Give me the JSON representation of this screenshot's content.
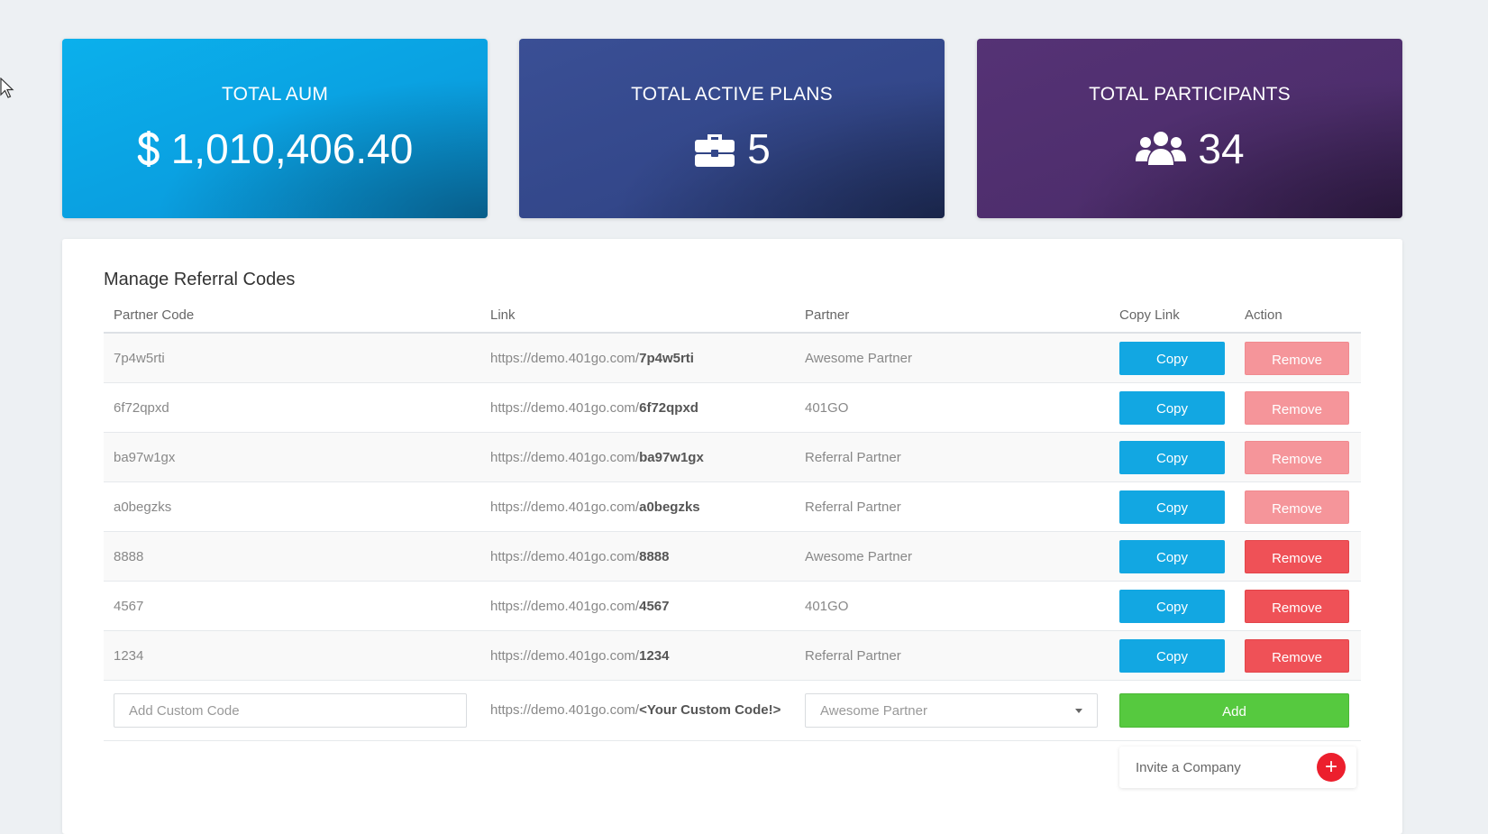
{
  "stats": [
    {
      "label": "TOTAL AUM",
      "value": "1,010,406.40",
      "icon": "dollar-icon",
      "color": "#0aa8e6"
    },
    {
      "label": "TOTAL ACTIVE PLANS",
      "value": "5",
      "icon": "briefcase-icon",
      "color": "#33478a"
    },
    {
      "label": "TOTAL PARTICIPANTS",
      "value": "34",
      "icon": "users-icon",
      "color": "#4e2e6d"
    }
  ],
  "referral": {
    "title": "Manage Referral Codes",
    "columns": [
      "Partner Code",
      "Link",
      "Partner",
      "Copy Link",
      "Action"
    ],
    "link_base": "https://demo.401go.com/",
    "rows": [
      {
        "code": "7p4w5rti",
        "partner": "Awesome Partner",
        "copy": "Copy",
        "remove": "Remove"
      },
      {
        "code": "6f72qpxd",
        "partner": "401GO",
        "copy": "Copy",
        "remove": "Remove"
      },
      {
        "code": "ba97w1gx",
        "partner": "Referral Partner",
        "copy": "Copy",
        "remove": "Remove"
      },
      {
        "code": "a0begzks",
        "partner": "Referral Partner",
        "copy": "Copy",
        "remove": "Remove"
      },
      {
        "code": "8888",
        "partner": "Awesome Partner",
        "copy": "Copy",
        "remove": "Remove"
      },
      {
        "code": "4567",
        "partner": "401GO",
        "copy": "Copy",
        "remove": "Remove"
      },
      {
        "code": "1234",
        "partner": "Referral Partner",
        "copy": "Copy",
        "remove": "Remove"
      }
    ],
    "add_row": {
      "code_placeholder": "Add Custom Code",
      "link_base": "https://demo.401go.com/",
      "link_custom": "<Your Custom Code!>",
      "partner_selected": "Awesome Partner",
      "add_label": "Add"
    },
    "invite_label": "Invite a Company"
  },
  "colors": {
    "copy": "#12a7e2",
    "remove": "#ef5157",
    "add": "#56c93f",
    "invite_plus": "#ec1f2d"
  }
}
